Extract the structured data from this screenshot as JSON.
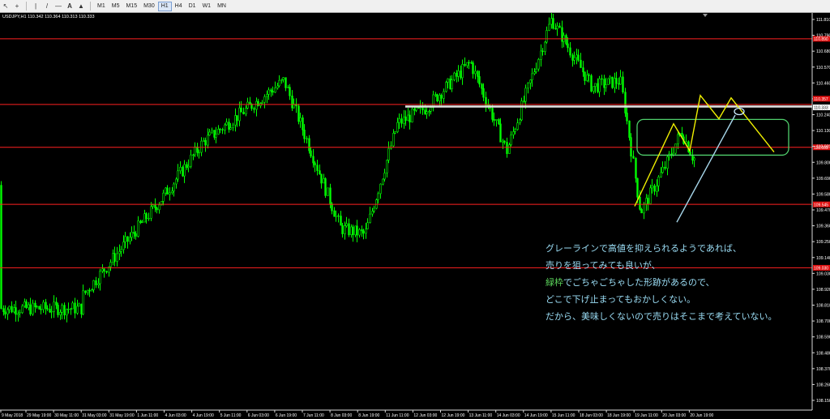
{
  "toolbar": {
    "tool_icons": [
      "cursor-icon",
      "crosshair-icon",
      "vertical-line-icon",
      "trendline-icon",
      "hline-icon",
      "text-icon",
      "shapes-icon"
    ],
    "timeframes": [
      "M1",
      "M5",
      "M15",
      "M30",
      "H1",
      "H4",
      "D1",
      "W1",
      "MN"
    ],
    "active_timeframe": "H1"
  },
  "chart_header": "USDJPY,H1  110.342 110.364 110.313 110.333",
  "chart_data": {
    "type": "candlestick",
    "symbol": "USDJPY",
    "timeframe": "H1",
    "ohlc": {
      "open": 110.342,
      "high": 110.364,
      "low": 110.313,
      "close": 110.333
    },
    "ylim": [
      107.94,
      111.08
    ],
    "y_ticks": [
      "111.810",
      "110.790",
      "110.680",
      "110.570",
      "110.460",
      "110.350",
      "110.240",
      "110.130",
      "110.020",
      "109.800",
      "109.690",
      "109.580",
      "109.470",
      "109.360",
      "109.250",
      "109.140",
      "109.030",
      "108.920",
      "108.810",
      "108.700",
      "108.590",
      "108.480",
      "108.370",
      "108.260",
      "108.150"
    ],
    "x_ticks": [
      "9 May 2018",
      "29 May 19:00",
      "30 May 11:00",
      "31 May 03:00",
      "31 May 19:00",
      "1 Jun 11:00",
      "4 Jun 03:00",
      "4 Jun 19:00",
      "5 Jun 11:00",
      "6 Jun 03:00",
      "6 Jun 19:00",
      "7 Jun 11:00",
      "8 Jun 03:00",
      "8 Jun 19:00",
      "11 Jun 11:00",
      "12 Jun 03:00",
      "12 Jun 19:00",
      "13 Jun 11:00",
      "14 Jun 03:00",
      "14 Jun 19:00",
      "15 Jun 11:00",
      "18 Jun 03:00",
      "18 Jun 19:00",
      "19 Jun 11:00",
      "20 Jun 03:00",
      "20 Jun 19:00"
    ],
    "bid_price": "110.333",
    "price_marks": [
      "110.357",
      "110.333"
    ],
    "horizontal_lines": [
      {
        "price": 110.89,
        "label": "110.890",
        "color": "#ff2020"
      },
      {
        "price": 110.357,
        "color": "#ff2020"
      },
      {
        "price": 110.009,
        "label": "110.009",
        "color": "#ff2020"
      },
      {
        "price": 109.545,
        "label": "109.545",
        "color": "#ff2020"
      },
      {
        "price": 109.03,
        "label": "109.030",
        "color": "#ff2020"
      }
    ],
    "key_points": [
      [
        110.5,
        109.7
      ],
      [
        100,
        108.7
      ],
      [
        40,
        108.3
      ],
      [
        200,
        109.6
      ],
      [
        250,
        110.05
      ],
      [
        350,
        110.55
      ],
      [
        420,
        109.35
      ],
      [
        450,
        109.3
      ],
      [
        490,
        110.2
      ],
      [
        525,
        110.33
      ],
      [
        580,
        110.7
      ],
      [
        625,
        109.98
      ],
      [
        680,
        111.05
      ],
      [
        730,
        110.5
      ],
      [
        765,
        110.55
      ],
      [
        772,
        110.27
      ],
      [
        790,
        109.48
      ],
      [
        820,
        109.85
      ],
      [
        840,
        110.14
      ],
      [
        855,
        109.92
      ]
    ],
    "annotation_lines": [
      {
        "color": "#f0f000",
        "points": [
          [
            783,
            109.53
          ],
          [
            831,
            110.2
          ],
          [
            851,
            109.98
          ],
          [
            864,
            110.43
          ],
          [
            887,
            110.24
          ],
          [
            902,
            110.41
          ],
          [
            955,
            109.97
          ]
        ]
      },
      {
        "color": "#a8d8ec",
        "points": [
          [
            835,
            109.4
          ],
          [
            907,
            110.27
          ]
        ]
      }
    ],
    "gray_line": {
      "price": 110.34,
      "x1": 500,
      "x2": 1002,
      "color": "#dcdcdc"
    },
    "box": {
      "x1": 786,
      "x2": 973,
      "y_top": 110.235,
      "y_bottom": 109.945,
      "color": "#4fcf6c"
    },
    "ellipse_marker": {
      "x": 912,
      "price": 110.3,
      "color": "#ccecff"
    }
  },
  "note": {
    "line1": "グレーラインで高値を抑えられるようであれば、",
    "line2": "売りを狙ってみても良いが、",
    "line3_highlight": "緑枠",
    "line3_rest": "でごちゃごちゃした形跡があるので、",
    "line4": "どこで下げ止まってもおかしくない。",
    "line5": "だから、美味しくないので売りはそこまで考えていない。"
  },
  "colors": {
    "background": "#000000",
    "candle": "#00ff00",
    "axis_text": "#ffffff",
    "note_text": "#9adcf4",
    "note_highlight": "#5ad35a"
  }
}
